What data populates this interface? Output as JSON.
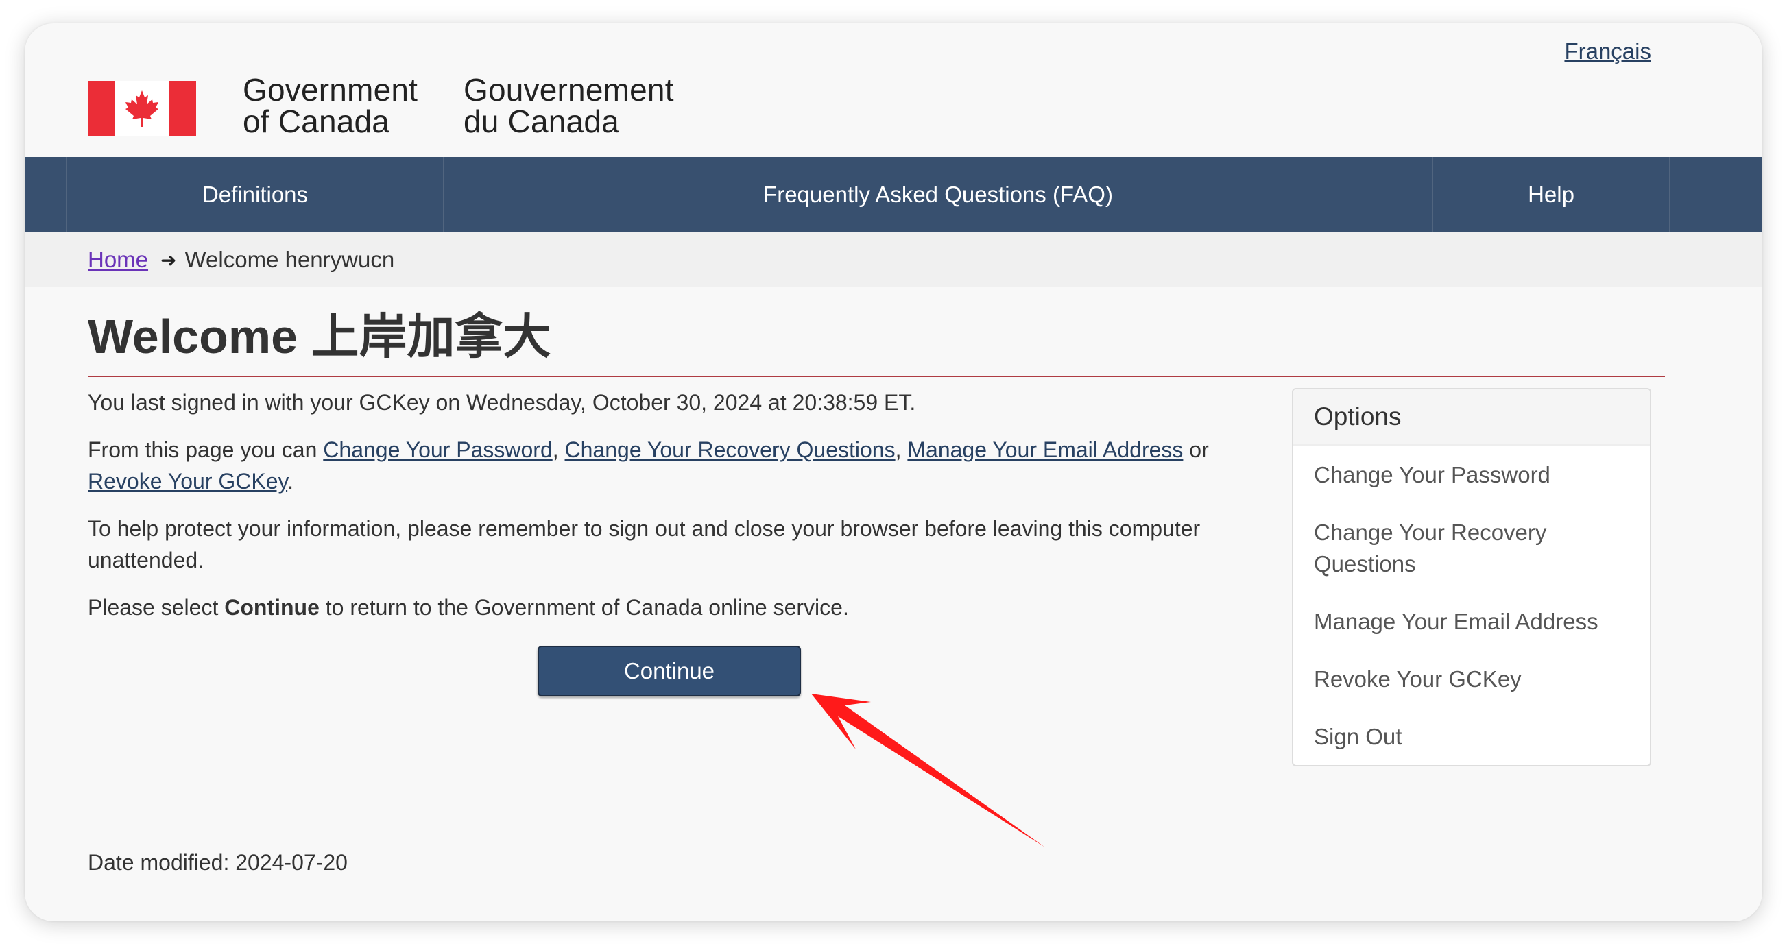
{
  "header": {
    "language_link": "Français",
    "signature_en": "Government\nof Canada",
    "signature_fr": "Gouvernement\ndu Canada"
  },
  "menu": {
    "items": [
      {
        "label": "Definitions"
      },
      {
        "label": "Frequently Asked Questions (FAQ)"
      },
      {
        "label": "Help"
      }
    ]
  },
  "breadcrumb": {
    "home": "Home",
    "current": "Welcome henrywucn"
  },
  "main": {
    "title": "Welcome 上岸加拿大",
    "last_signed_in": "You last signed in with your GCKey on Wednesday, October 30, 2024 at 20:38:59 ET.",
    "links_intro": "From this page you can ",
    "link_change_password": "Change Your Password",
    "sep1": ", ",
    "link_change_recovery": "Change Your Recovery Questions",
    "sep2": ", ",
    "link_manage_email": "Manage Your Email Address",
    "sep3": " or ",
    "link_revoke": "Revoke Your GCKey",
    "sep4": ".",
    "protect_notice": "To help protect your information, please remember to sign out and close your browser before leaving this computer unattended.",
    "select_prefix": "Please select ",
    "select_bold": "Continue",
    "select_suffix": " to return to the Government of Canada online service.",
    "continue_label": "Continue"
  },
  "options_panel": {
    "title": "Options",
    "items": [
      {
        "label": "Change Your Password"
      },
      {
        "label": "Change Your Recovery Questions"
      },
      {
        "label": "Manage Your Email Address"
      },
      {
        "label": "Revoke Your GCKey"
      },
      {
        "label": "Sign Out"
      }
    ]
  },
  "footer": {
    "date_modified": "Date modified: 2024-07-20"
  },
  "colors": {
    "menu_bar": "#38506f",
    "flag_red": "#eb2d37",
    "title_rule": "#af3c43",
    "button": "#335075",
    "annotation_arrow": "#ff0000"
  },
  "icons": {
    "breadcrumb_separator": "arrow-right-icon",
    "flag": "canada-flag-icon",
    "annotation": "red-pointer-arrow"
  }
}
